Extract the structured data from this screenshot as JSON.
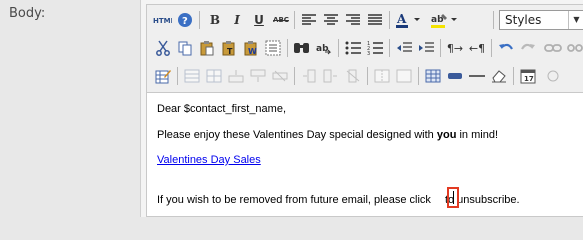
{
  "field": {
    "label": "Body:"
  },
  "toolbar": {
    "styles_value": "Styles"
  },
  "content": {
    "greeting": "Dear $contact_first_name,",
    "line2_before": "Please enjoy these Valentines Day special designed with ",
    "line2_bold": "you",
    "line2_after": " in mind!",
    "link_text": "Valentines Day Sales",
    "line4_before": "If you wish to be removed from future email, please click ",
    "line4_after": "to unsubscribe."
  },
  "colors": {
    "link": "#0000ee",
    "highlight_box": "#e23a22"
  }
}
